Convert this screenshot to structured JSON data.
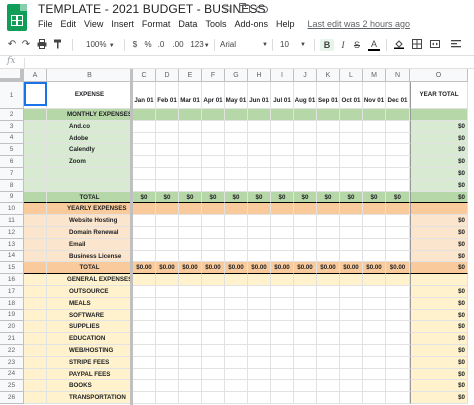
{
  "doc": {
    "title": "TEMPLATE - 2021 BUDGET - BUSINESS",
    "star_icon": "☆",
    "last_edit": "Last edit was 2 hours ago"
  },
  "menu": [
    "File",
    "Edit",
    "View",
    "Insert",
    "Format",
    "Data",
    "Tools",
    "Add-ons",
    "Help"
  ],
  "toolbar": {
    "zoom": "100%",
    "currency": "$",
    "percent": "%",
    "dec_less": ".0",
    "dec_more": ".00",
    "more_formats": "123",
    "font": "Arial",
    "font_size": "10",
    "bold": "B",
    "italic": "I",
    "strike": "S",
    "text_color": "A"
  },
  "formula": {
    "fx": "fx",
    "value": ""
  },
  "columns": [
    "A",
    "B",
    "C",
    "D",
    "E",
    "F",
    "G",
    "H",
    "I",
    "J",
    "K",
    "L",
    "M",
    "N",
    "O"
  ],
  "header_row": {
    "expense": "EXPENSE",
    "months": [
      "Jan 01",
      "Feb 01",
      "Mar 01",
      "Apr 01",
      "May 01",
      "Jun 01",
      "Jul 01",
      "Aug 01",
      "Sep 01",
      "Oct 01",
      "Nov 01",
      "Dec 01"
    ],
    "year_total": "YEAR TOTAL"
  },
  "rows": [
    {
      "num": "1"
    },
    {
      "num": "2",
      "label": "MONTHLY EXPENSES",
      "style": "green-dark",
      "section": true
    },
    {
      "num": "3",
      "label": "And.co",
      "style": "green",
      "total": "$0"
    },
    {
      "num": "4",
      "label": "Adobe",
      "style": "green",
      "total": "$0"
    },
    {
      "num": "5",
      "label": "Calendly",
      "style": "green",
      "total": "$0"
    },
    {
      "num": "6",
      "label": "Zoom",
      "style": "green",
      "total": "$0"
    },
    {
      "num": "7",
      "label": "",
      "style": "green",
      "total": "$0"
    },
    {
      "num": "8",
      "label": "",
      "style": "green",
      "total": "$0"
    },
    {
      "num": "9",
      "label": "TOTAL",
      "style": "green-dark",
      "totalrow": true,
      "month_values": [
        "$0",
        "$0",
        "$0",
        "$0",
        "$0",
        "$0",
        "$0",
        "$0",
        "$0",
        "$0",
        "$0",
        "$0"
      ],
      "total": "$0"
    },
    {
      "num": "10",
      "label": "YEARLY EXPENSES",
      "style": "orange-dark",
      "section": true
    },
    {
      "num": "11",
      "label": "Website Hosting",
      "style": "orange",
      "total": "$0"
    },
    {
      "num": "12",
      "label": "Domain Renewal",
      "style": "orange",
      "total": "$0"
    },
    {
      "num": "13",
      "label": "Email",
      "style": "orange",
      "total": "$0"
    },
    {
      "num": "14",
      "label": "Business License",
      "style": "orange",
      "total": "$0"
    },
    {
      "num": "15",
      "label": "TOTAL",
      "style": "orange-dark",
      "totalrow": true,
      "month_values": [
        "$0.00",
        "$0.00",
        "$0.00",
        "$0.00",
        "$0.00",
        "$0.00",
        "$0.00",
        "$0.00",
        "$0.00",
        "$0.00",
        "$0.00",
        "$0.00"
      ],
      "total": "$0"
    },
    {
      "num": "16",
      "label": "GENERAL EXPENSES",
      "style": "yellow",
      "section": true
    },
    {
      "num": "17",
      "label": "OUTSOURCE",
      "style": "yellow",
      "total": "$0"
    },
    {
      "num": "18",
      "label": "MEALS",
      "style": "yellow",
      "total": "$0"
    },
    {
      "num": "19",
      "label": "SOFTWARE",
      "style": "yellow",
      "total": "$0"
    },
    {
      "num": "20",
      "label": "SUPPLIES",
      "style": "yellow",
      "total": "$0"
    },
    {
      "num": "21",
      "label": "EDUCATION",
      "style": "yellow",
      "total": "$0"
    },
    {
      "num": "22",
      "label": "WEB/HOSTING",
      "style": "yellow",
      "total": "$0"
    },
    {
      "num": "23",
      "label": "STRIPE FEES",
      "style": "yellow",
      "total": "$0"
    },
    {
      "num": "24",
      "label": "PAYPAL FEES",
      "style": "yellow",
      "total": "$0"
    },
    {
      "num": "25",
      "label": "BOOKS",
      "style": "yellow",
      "total": "$0"
    },
    {
      "num": "26",
      "label": "TRANSPORTATION",
      "style": "yellow",
      "total": "$0"
    }
  ],
  "colors": {
    "green": "#d9ead3",
    "green_dark": "#b6d7a8",
    "orange": "#fce5cd",
    "orange_dark": "#f9cb9c",
    "yellow": "#fff2cc",
    "selection": "#1a73e8"
  },
  "icons": [
    "sheets-logo-icon",
    "star-icon",
    "folder-icon",
    "cloud-icon",
    "undo-icon",
    "redo-icon",
    "print-icon",
    "paint-format-icon",
    "fill-color-icon",
    "chevron-down-icon"
  ]
}
